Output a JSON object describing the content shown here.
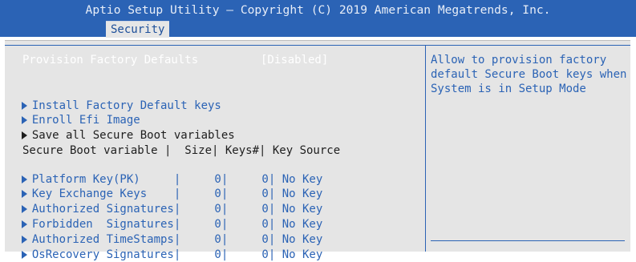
{
  "header": {
    "title": "Aptio Setup Utility – Copyright (C) 2019 American Megatrends, Inc.",
    "tab": "Security"
  },
  "settings": {
    "provision_label": "Provision Factory Defaults",
    "provision_value": "[Disabled]",
    "install_label": "Install Factory Default keys",
    "enroll_label": "Enroll Efi Image",
    "save_label": "Save all Secure Boot variables"
  },
  "table": {
    "header": "Secure Boot variable |  Size| Keys#| Key Source",
    "rows": [
      {
        "text": "Platform Key(PK)     |     0|     0| No Key"
      },
      {
        "text": "Key Exchange Keys    |     0|     0| No Key"
      },
      {
        "text": "Authorized Signatures|     0|     0| No Key"
      },
      {
        "text": "Forbidden  Signatures|     0|     0| No Key"
      },
      {
        "text": "Authorized TimeStamps|     0|     0| No Key"
      },
      {
        "text": "OsRecovery Signatures|     0|     0| No Key"
      }
    ]
  },
  "help": {
    "text": "Allow to provision factory\ndefault Secure Boot keys when\nSystem is in Setup Mode"
  },
  "colors": {
    "header_bg": "#2b63b5",
    "panel_bg": "#e5e5e5",
    "selected_text": "#ffffff",
    "link_text": "#2b63b5"
  }
}
